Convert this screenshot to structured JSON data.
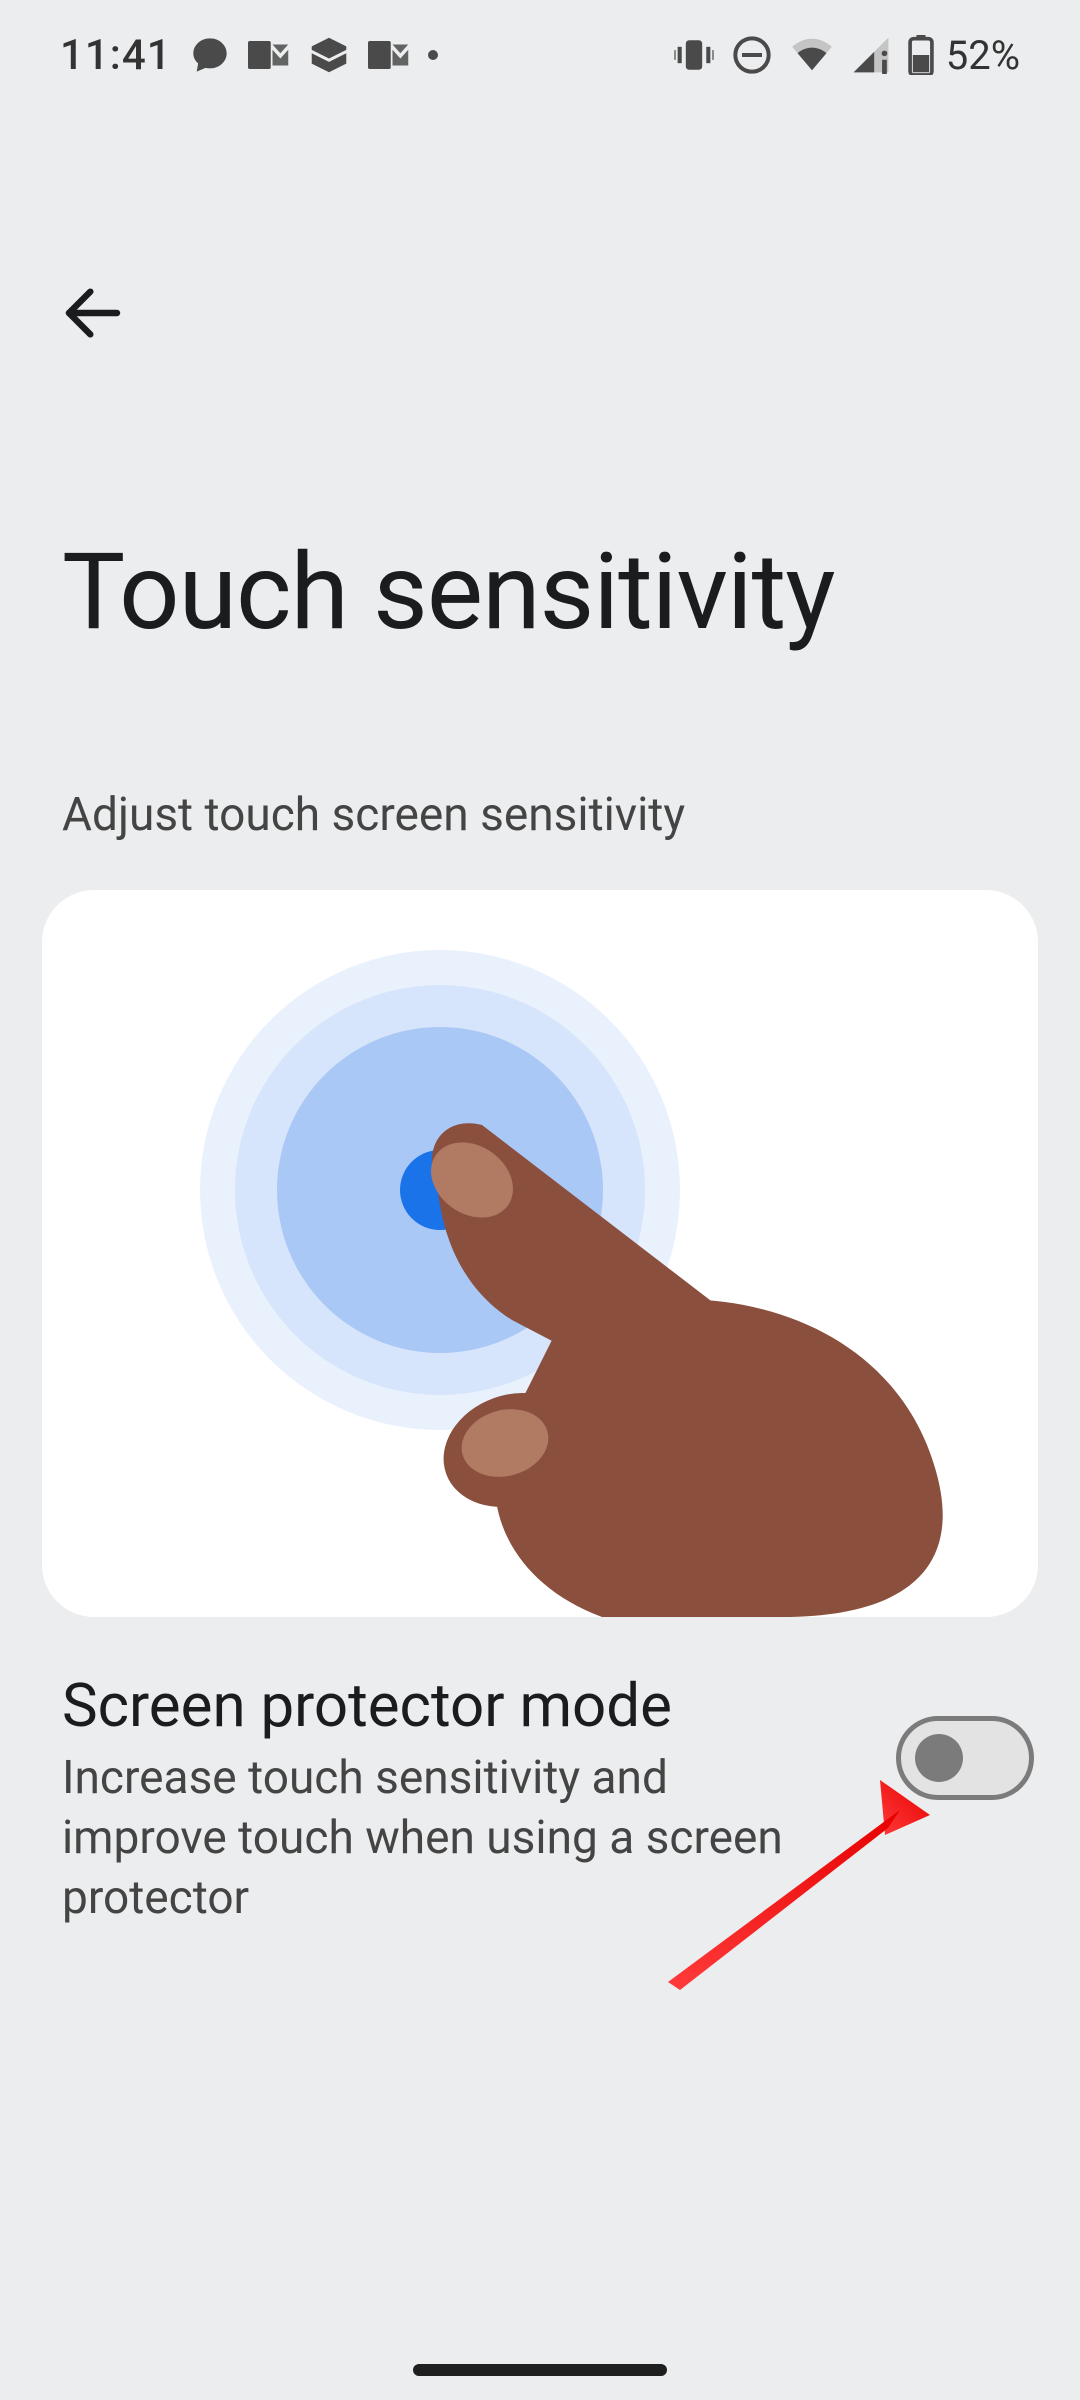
{
  "status": {
    "time": "11:41",
    "battery_pct": "52%"
  },
  "page": {
    "title": "Touch sensitivity",
    "subhead": "Adjust touch screen sensitivity"
  },
  "settings": {
    "screen_protector": {
      "title": "Screen protector mode",
      "description": "Increase touch sensitivity and improve touch when using a screen protector",
      "enabled": false
    }
  }
}
